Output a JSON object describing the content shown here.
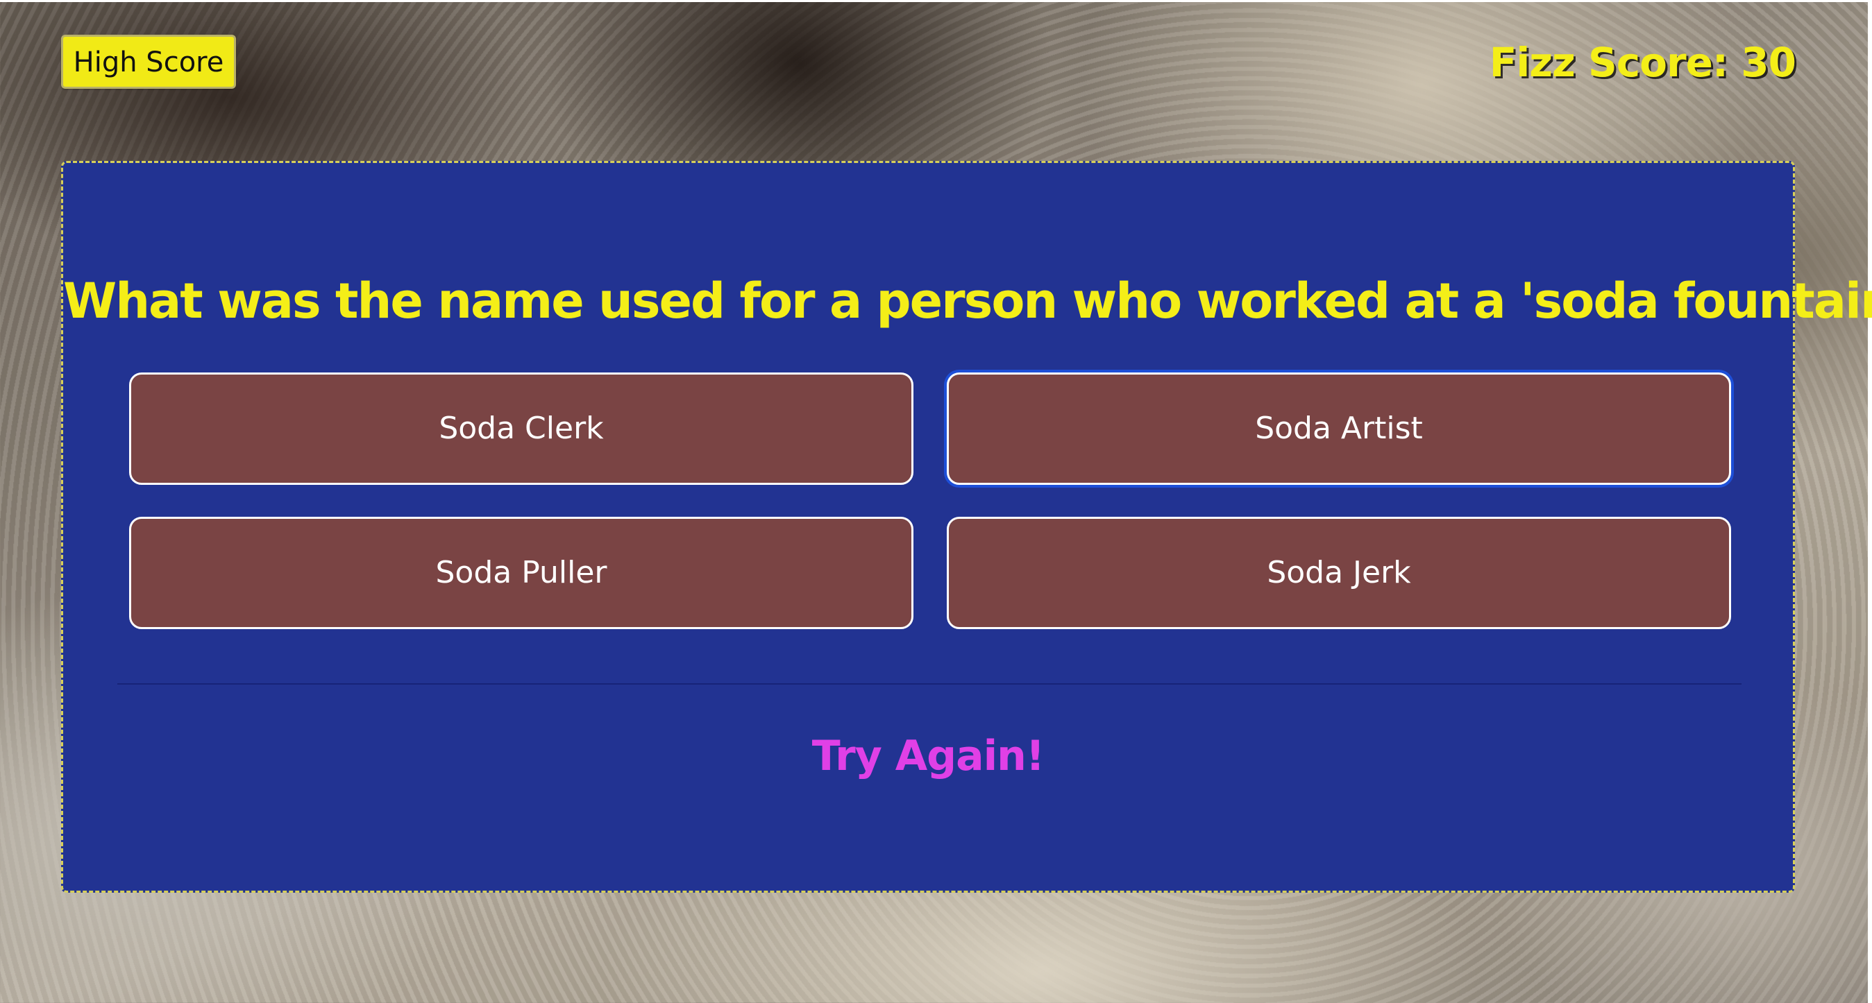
{
  "header": {
    "high_score_label": "High Score",
    "fizz_score_label": "Fizz Score: 30"
  },
  "quiz": {
    "question": "What was the name used for a person who worked at a 'soda fountain'?",
    "answers": [
      {
        "label": "Soda Clerk"
      },
      {
        "label": "Soda Artist"
      },
      {
        "label": "Soda Puller"
      },
      {
        "label": "Soda Jerk"
      }
    ],
    "feedback": "Try Again!"
  },
  "colors": {
    "panel_bg": "#223392",
    "accent_yellow": "#f4ee18",
    "answer_bg": "#7a4444",
    "feedback_magenta": "#e040e6"
  }
}
